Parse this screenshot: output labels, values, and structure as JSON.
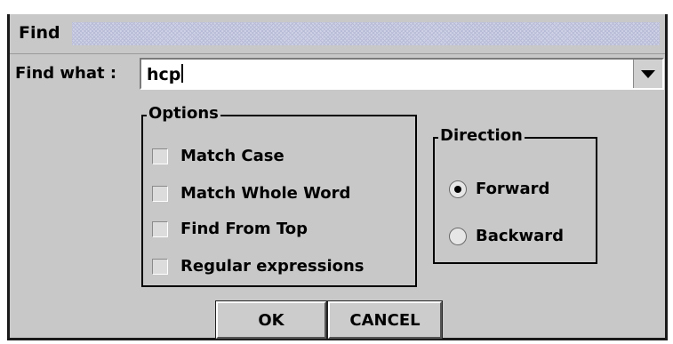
{
  "dialog": {
    "title": "Find"
  },
  "find": {
    "label": "Find what :",
    "value": "hcp"
  },
  "options": {
    "title": "Options",
    "items": [
      {
        "label": "Match Case",
        "checked": false
      },
      {
        "label": "Match Whole Word",
        "checked": false
      },
      {
        "label": "Find From Top",
        "checked": false
      },
      {
        "label": "Regular expressions",
        "checked": false
      }
    ]
  },
  "direction": {
    "title": "Direction",
    "items": [
      {
        "label": "Forward",
        "selected": true
      },
      {
        "label": "Backward",
        "selected": false
      }
    ]
  },
  "buttons": {
    "ok": "OK",
    "cancel": "CANCEL"
  },
  "colors": {
    "background": "#c8c8c8",
    "grip": "#d0d3e8",
    "frame": "#1a1a1a"
  },
  "icons": {
    "dropdown": "chevron-down-icon",
    "radio_selected": "radio-dot-icon"
  }
}
